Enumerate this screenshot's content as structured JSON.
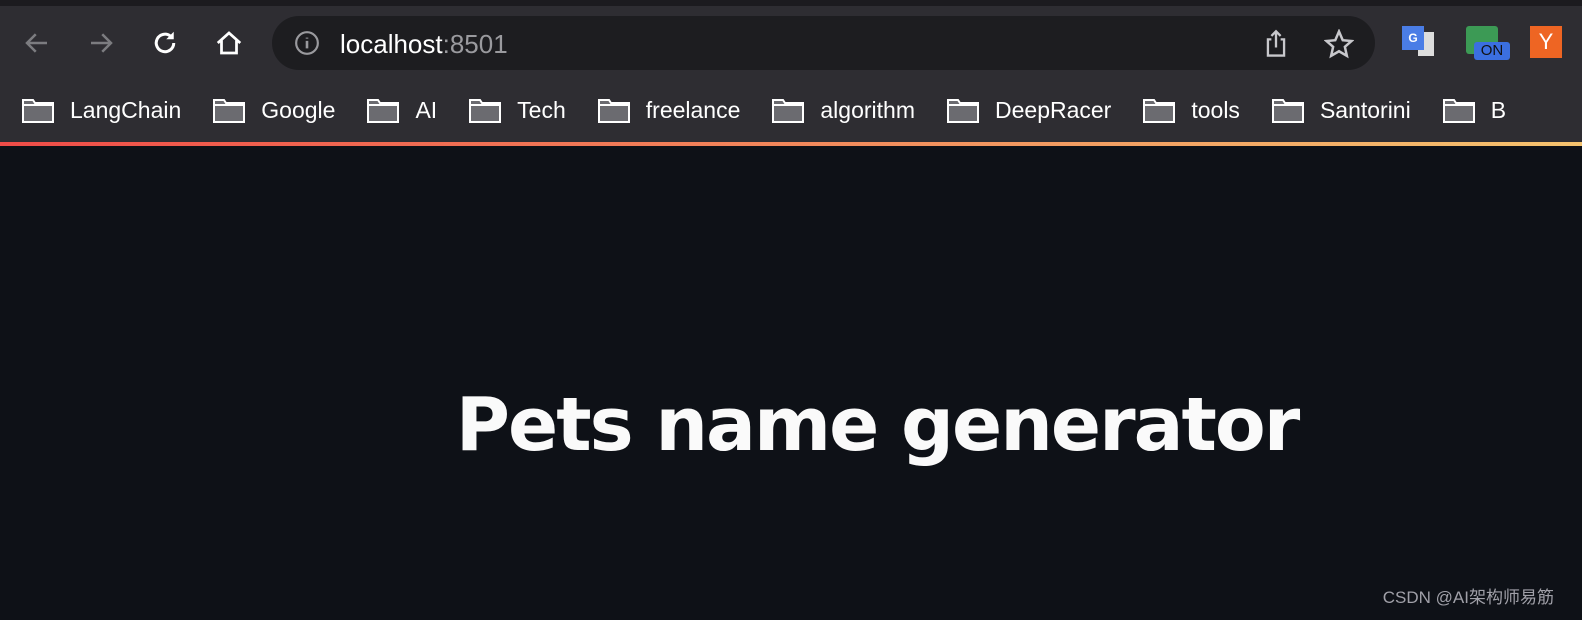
{
  "browser": {
    "url_host": "localhost",
    "url_port": ":8501",
    "extensions": [
      {
        "name": "google-translate",
        "label": "G"
      },
      {
        "name": "info-on",
        "label": "ON"
      },
      {
        "name": "y-combinator",
        "label": "Y"
      }
    ],
    "bookmarks": [
      "LangChain",
      "Google",
      "AI",
      "Tech",
      "freelance",
      "algorithm",
      "DeepRacer",
      "tools",
      "Santorini",
      "B"
    ]
  },
  "page": {
    "title": "Pets name generator"
  },
  "watermark": "CSDN @AI架构师易筋",
  "colors": {
    "background": "#0e1117",
    "toolbar": "#2e2d32",
    "accent_start": "#ef4c48",
    "accent_end": "#f5c36e"
  }
}
